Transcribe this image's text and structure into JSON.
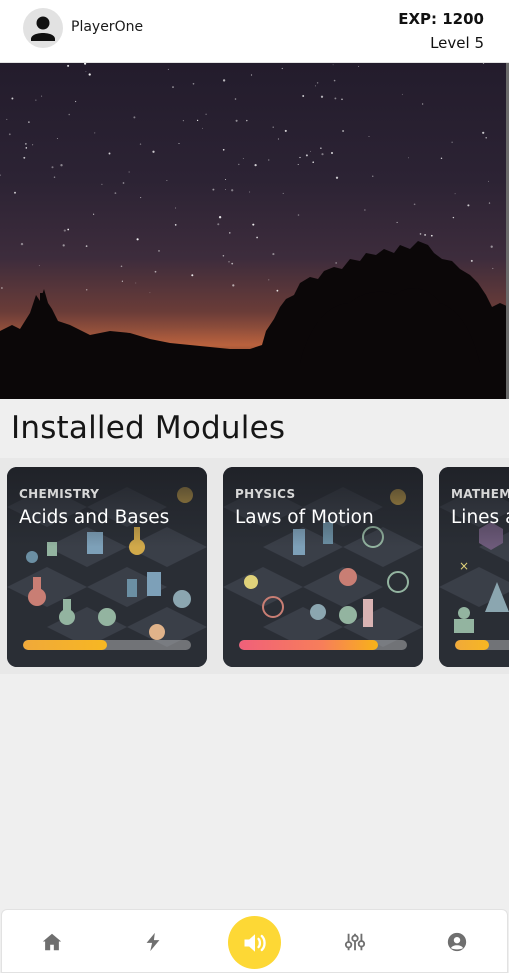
{
  "header": {
    "username": "PlayerOne",
    "exp": "EXP: 1200",
    "level": "Level 5",
    "avatar_icon": "person-icon"
  },
  "hero": {
    "image": "night-sky-silhouette-trees"
  },
  "modules": {
    "title": "Installed Modules",
    "items": [
      {
        "category": "CHEMISTRY",
        "title": "Acids and Bases",
        "progress": 0.5,
        "art": "chemistry-flasks-pattern"
      },
      {
        "category": "PHYSICS",
        "title": "Laws of Motion",
        "progress": 0.83,
        "art": "physics-atoms-pattern"
      },
      {
        "category": "MATHEMATICS",
        "title": "Lines and Angles",
        "progress": 0.2,
        "art": "math-shapes-pattern"
      }
    ]
  },
  "nav": {
    "items": [
      {
        "icon": "home-icon"
      },
      {
        "icon": "lightning-icon"
      },
      {
        "icon": "speaker-icon"
      },
      {
        "icon": "sliders-icon"
      },
      {
        "icon": "account-circle-icon"
      }
    ]
  },
  "colors": {
    "accent": "#fdd835",
    "progress_orange": "#f7b722",
    "progress_pink": "#f0607a",
    "nav_icon": "#6f6f6f"
  }
}
